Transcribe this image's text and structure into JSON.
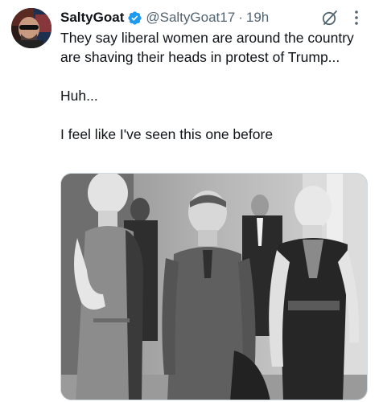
{
  "tweet": {
    "author": {
      "display_name": "SaltyGoat",
      "handle": "@SaltyGoat17",
      "verified": true,
      "avatar_icon": "avatar-photo"
    },
    "separator": "·",
    "timestamp": "19h",
    "text_lines": [
      "They say liberal women are around the country are shaving their heads in protest of Trump...",
      "Huh...",
      "I feel like I've seen this one before"
    ],
    "media": {
      "type": "photo",
      "style": "black-and-white"
    },
    "icons": {
      "verified": "verified-badge-icon",
      "grok": "grok-icon",
      "more": "more-options-icon"
    }
  },
  "colors": {
    "primary_text": "#0f1419",
    "secondary_text": "#536471",
    "verified_blue": "#1d9bf0"
  }
}
